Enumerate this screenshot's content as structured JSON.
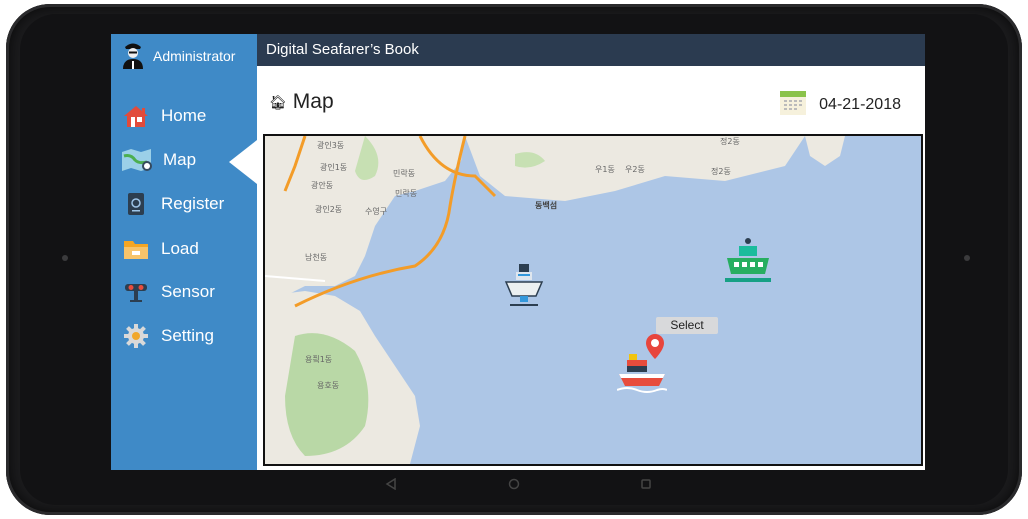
{
  "sidebar": {
    "user": "Administrator",
    "items": [
      {
        "label": "Home",
        "icon": "home-icon"
      },
      {
        "label": "Map",
        "icon": "map-icon"
      },
      {
        "label": "Register",
        "icon": "passport-icon"
      },
      {
        "label": "Load",
        "icon": "folder-icon"
      },
      {
        "label": "Sensor",
        "icon": "sensor-icon"
      },
      {
        "label": "Setting",
        "icon": "gear-icon"
      }
    ],
    "selected": "Map"
  },
  "app": {
    "title": "Digital Seafarer’s Book"
  },
  "page": {
    "title": "Map",
    "date": "04-21-2018"
  },
  "map": {
    "select_label": "Select",
    "place_labels": [
      "광인3동",
      "광인1동",
      "광안동",
      "광인2동",
      "수영구",
      "민락동",
      "민락동",
      "우1동",
      "우2동",
      "정2동",
      "동백섬",
      "남천동",
      "용픸1동",
      "용호동",
      "정2동"
    ]
  },
  "colors": {
    "sidebar": "#3f8ac7",
    "topbar": "#2b3b50",
    "sea": "#adc6e6",
    "land": "#ece9e1",
    "marker": "#e8453c"
  }
}
